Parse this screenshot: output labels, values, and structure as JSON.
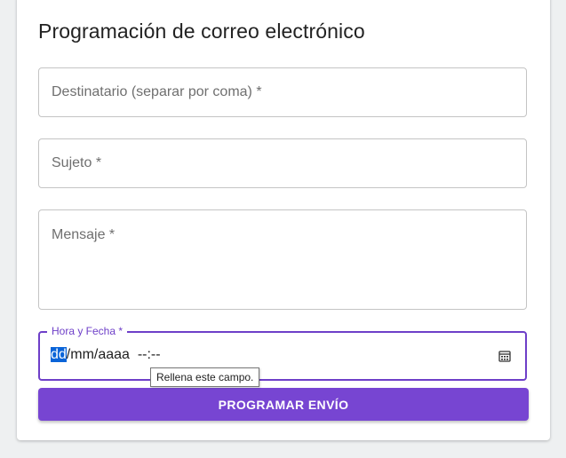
{
  "form": {
    "title": "Programación de correo electrónico",
    "recipient_label": "Destinatario (separar por coma) *",
    "subject_label": "Sujeto *",
    "message_label": "Mensaje *",
    "datetime_label": "Hora y Fecha *",
    "datetime_value": {
      "day": "dd",
      "rest": "/mm/aaaa  --:--"
    },
    "calendar_icon": "calendar-icon",
    "submit_label": "PROGRAMAR ENVÍO"
  },
  "tooltip": {
    "text": "Rellena este campo."
  },
  "colors": {
    "accent": "#7745d2",
    "focus_border": "#6e3fc8",
    "selection": "#0a64d8"
  }
}
